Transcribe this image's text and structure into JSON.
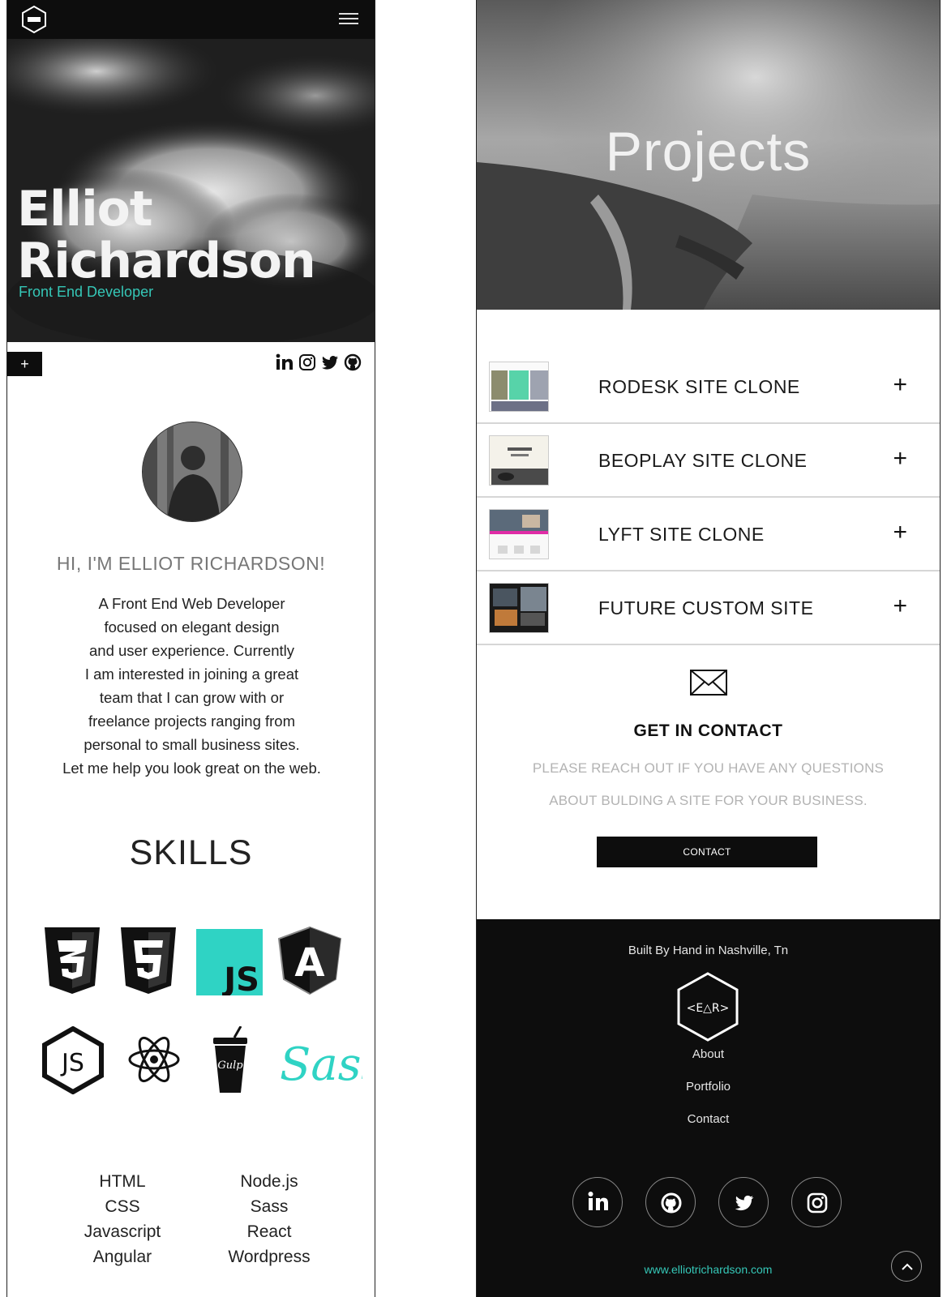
{
  "left": {
    "hero": {
      "name_line1": "Elliot",
      "name_line2": "Richardson",
      "role": "Front End Developer"
    },
    "subbar": {
      "plus_label": "+"
    },
    "intro": {
      "heading": "HI, I'M ELLIOT RICHARDSON!",
      "bio_lines": [
        "A Front End Web Developer",
        "focused on elegant design",
        "and user experience. Currently",
        "I am interested in joining a great",
        "team that I can grow with or",
        "freelance projects ranging from",
        "personal to small business sites.",
        "Let me help you look great on the web."
      ]
    },
    "skills": {
      "title": "SKILLS",
      "icons": [
        "css3-icon",
        "html5-icon",
        "javascript-icon",
        "angular-icon",
        "nodejs-icon",
        "react-icon",
        "gulp-icon",
        "sass-icon"
      ],
      "js_tile_text": "JS",
      "angular_letter": "A",
      "node_text": "JS",
      "gulp_text": "Gulp",
      "sass_text": "Sass",
      "col1": [
        "HTML",
        "CSS",
        "Javascript",
        "Angular"
      ],
      "col2": [
        "Node.js",
        "Sass",
        "React",
        "Wordpress"
      ]
    },
    "accent_color": "#35c7b7"
  },
  "right": {
    "hero_title": "Projects",
    "projects": [
      {
        "label": "RODESK SITE CLONE",
        "expand": "+"
      },
      {
        "label": "BEOPLAY SITE CLONE",
        "expand": "+"
      },
      {
        "label": "LYFT SITE CLONE",
        "expand": "+"
      },
      {
        "label": "FUTURE CUSTOM SITE",
        "expand": "+"
      }
    ],
    "contact": {
      "title": "GET IN CONTACT",
      "sub_line1": "PLEASE REACH OUT IF YOU HAVE ANY QUESTIONS",
      "sub_line2": "ABOUT BULDING A SITE FOR YOUR BUSINESS.",
      "button": "CONTACT"
    },
    "footer": {
      "built": "Built By Hand in Nashville, Tn",
      "logo_text": "<E△R>",
      "links": [
        "About",
        "Portfolio",
        "Contact"
      ],
      "social": [
        "linkedin-icon",
        "github-icon",
        "twitter-icon",
        "instagram-icon"
      ],
      "url": "www.elliotrichardson.com"
    }
  }
}
